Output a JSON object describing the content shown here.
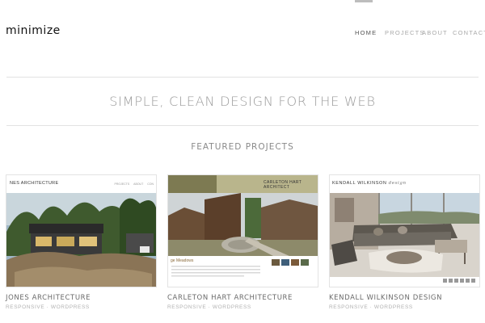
{
  "logo": "minimize",
  "nav": {
    "items": [
      "HOME",
      "PROJECTS",
      "ABOUT",
      "CONTACT"
    ],
    "active": "HOME"
  },
  "tagline": "SIMPLE, CLEAN DESIGN FOR THE WEB",
  "featured": {
    "title": "FEATURED PROJECTS",
    "projects": [
      {
        "title": "JONES ARCHITECTURE",
        "subtitle": "RESPONSIVE · WORDPRESS",
        "thumb_brand": "NES ARCHITECTURE",
        "thumb_nav": [
          "PROJECTS",
          "ABOUT",
          "CON"
        ]
      },
      {
        "title": "CARLETON HART ARCHITECTURE",
        "subtitle": "RESPONSIVE · WORDPRESS",
        "thumb_brand": "CARLETON HART ARCHITECT",
        "thumb_caption": "ge Meadows"
      },
      {
        "title": "KENDALL WILKINSON DESIGN",
        "subtitle": "RESPONSIVE · WORDPRESS",
        "thumb_brand": "KENDALL WILKINSON",
        "thumb_brand_italic": "design"
      }
    ]
  },
  "colors": {
    "text": "#6f6f6f",
    "muted": "#a9a9a9",
    "rule": "#e2e2e2",
    "accent": "#bdbdbd"
  }
}
